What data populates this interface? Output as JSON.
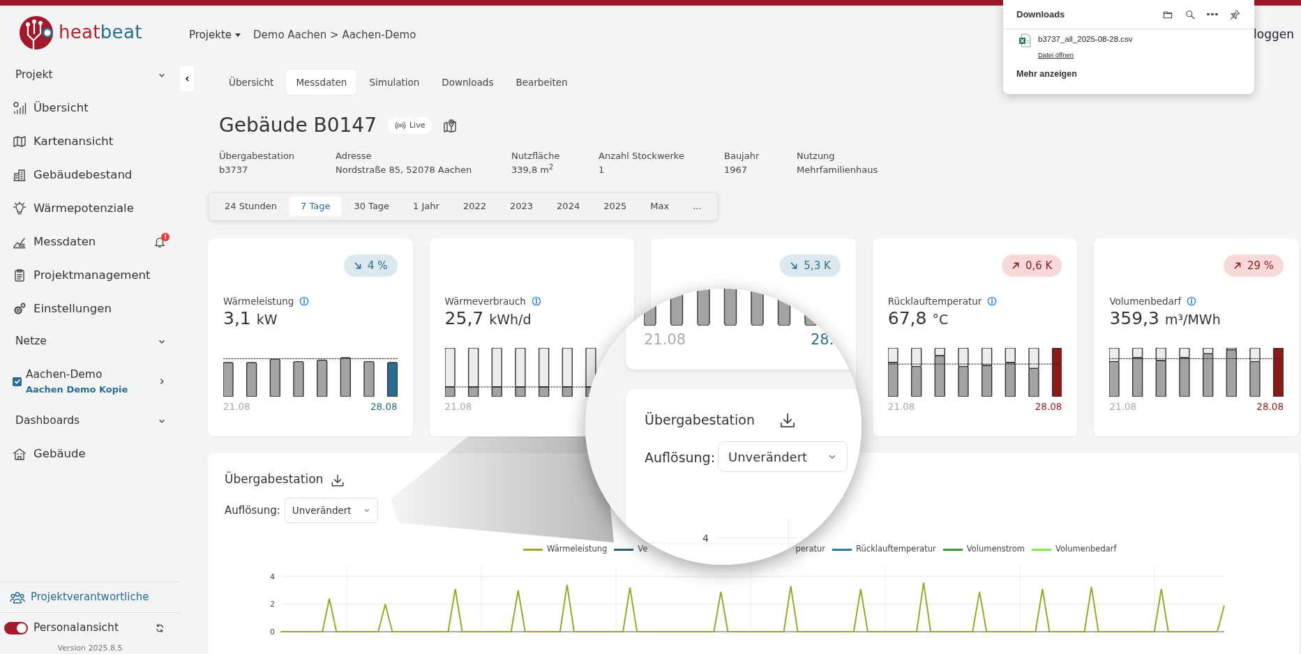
{
  "brand": {
    "part1": "heat",
    "part2": "beat"
  },
  "sidebar": {
    "groups": [
      {
        "title": "Projekt",
        "expanded": true,
        "items": [
          {
            "label": "Übersicht"
          },
          {
            "label": "Kartenansicht"
          },
          {
            "label": "Gebäudebestand"
          },
          {
            "label": "Wärmepotenziale"
          },
          {
            "label": "Messdaten",
            "alert": "!"
          },
          {
            "label": "Projektmanagement"
          },
          {
            "label": "Einstellungen"
          }
        ]
      },
      {
        "title": "Netze",
        "expanded": true,
        "networks": [
          {
            "name": "Aachen-Demo",
            "subtitle": "Aachen Demo Kopie",
            "checked": true
          }
        ]
      },
      {
        "title": "Dashboards",
        "expanded": true,
        "items": [
          {
            "label": "Gebäude"
          }
        ]
      }
    ],
    "footer_link": "Projektverantwortliche",
    "toggle": {
      "label": "Personalansicht",
      "on": true
    },
    "version": "Version 2025.8.5"
  },
  "header": {
    "projects_menu": "Projekte",
    "breadcrumb": "Demo Aachen > Aachen-Demo",
    "logout": "loggen"
  },
  "tabs": [
    {
      "label": "Übersicht",
      "selected": false
    },
    {
      "label": "Messdaten",
      "selected": true
    },
    {
      "label": "Simulation",
      "selected": false
    },
    {
      "label": "Downloads",
      "selected": false
    },
    {
      "label": "Bearbeiten",
      "selected": false
    }
  ],
  "building": {
    "title": "Gebäude B0147",
    "live": "Live",
    "facts": [
      {
        "label": "Übergabestation",
        "value": "b3737"
      },
      {
        "label": "Adresse",
        "value": "Nordstraße 85, 52078 Aachen"
      },
      {
        "label": "Nutzfläche",
        "value": "339,8 m$^{2}$"
      },
      {
        "label": "Anzahl Stockwerke",
        "value": "1"
      },
      {
        "label": "Baujahr",
        "value": "1967"
      },
      {
        "label": "Nutzung",
        "value": "Mehrfamilienhaus"
      }
    ]
  },
  "periods": [
    {
      "label": "24 Stunden",
      "selected": false
    },
    {
      "label": "7 Tage",
      "selected": true
    },
    {
      "label": "30 Tage",
      "selected": false
    },
    {
      "label": "1 Jahr",
      "selected": false
    },
    {
      "label": "2022",
      "selected": false
    },
    {
      "label": "2023",
      "selected": false
    },
    {
      "label": "2024",
      "selected": false
    },
    {
      "label": "2025",
      "selected": false
    },
    {
      "label": "Max",
      "selected": false
    },
    {
      "label": "...",
      "selected": false
    }
  ],
  "kpis": [
    {
      "title": "Wärmeleistung",
      "value": "3,1",
      "unit": "kW",
      "rising": false,
      "change": "4 %",
      "dates": [
        "21.08",
        "28.08"
      ]
    },
    {
      "title": "Wärmeverbrauch",
      "value": "25,7",
      "unit": "kWh/d",
      "dates": [
        "21.08"
      ]
    },
    {
      "rising": false,
      "change": "5,3 K"
    },
    {
      "title": "Rücklauftemperatur",
      "value": "67,8",
      "unit": "°C",
      "rising": true,
      "change": "0,6 K",
      "dates": [
        "21.08",
        "28.08"
      ]
    },
    {
      "title": "Volumenbedarf",
      "value": "359,3",
      "unit": "m³/MWh",
      "rising": true,
      "change": "29 %",
      "dates": [
        "21.08",
        "28.08"
      ]
    }
  ],
  "panel": {
    "title": "Übergabestation",
    "resolution_label": "Auflösung:",
    "resolution": "Unverändert",
    "legend": [
      {
        "label": "Ve",
        "color": "#2f5f7d"
      },
      {
        "label": "peratur",
        "covered_before": true
      },
      {
        "label": "Rücklauftemperatur",
        "color": "#2e78a8"
      },
      {
        "label": "Volumenstrom",
        "color": "#3a9a3a"
      },
      {
        "label": "Volumenbedarf",
        "color": "#7ce84a"
      }
    ],
    "chart_data": {
      "type": "line",
      "ylim": [
        0,
        4.8
      ],
      "yticks": [
        0,
        2,
        4
      ],
      "categories": [
        null,
        null,
        null,
        null,
        null,
        null,
        null,
        null,
        null,
        null,
        null,
        null,
        null,
        null,
        null,
        null,
        null,
        null,
        null,
        null,
        null,
        null,
        null,
        null,
        null,
        null,
        null,
        null,
        null,
        null,
        null,
        null,
        null,
        null,
        null,
        null,
        null,
        null,
        null,
        null,
        null,
        null,
        null,
        null,
        null,
        null,
        null,
        null,
        null,
        null,
        null,
        null,
        null,
        null,
        null,
        null,
        null,
        null,
        null,
        null,
        null,
        null,
        null,
        null,
        null,
        null,
        null,
        null,
        null,
        null,
        null,
        null,
        null,
        null,
        null,
        null,
        null,
        null,
        null,
        null,
        null,
        null,
        null,
        null,
        null,
        null,
        null,
        null,
        null,
        null,
        null,
        null,
        null,
        null,
        null,
        null,
        null,
        null,
        null,
        null,
        null,
        null,
        null,
        null,
        null,
        null,
        null,
        null,
        null,
        null,
        null,
        null,
        null,
        null,
        null,
        null,
        null,
        null,
        null,
        null,
        null,
        null,
        null,
        null,
        null,
        null,
        null,
        null,
        null,
        null,
        null,
        null,
        null,
        null,
        null,
        null
      ],
      "series": [
        {
          "name": "Wärmeleistung",
          "color": "#9ba62b",
          "values": [
            0,
            0,
            0,
            0,
            0,
            0,
            0,
            2.4,
            0,
            0,
            0,
            0,
            0,
            0,
            0,
            2.0,
            0,
            0,
            0,
            0,
            0,
            0,
            0,
            0,
            0,
            3.1,
            0,
            0,
            0,
            0,
            0,
            0,
            0,
            0,
            3.0,
            0,
            0,
            0,
            0,
            0,
            0,
            3.4,
            0,
            0,
            0,
            0,
            0,
            0,
            0,
            0,
            3.2,
            0,
            0,
            0,
            0,
            0,
            0,
            0,
            0,
            0,
            0,
            0,
            0,
            2.9,
            0,
            0,
            0,
            0,
            0,
            0,
            0,
            0,
            0,
            3.3,
            0,
            0,
            0,
            0,
            0,
            0,
            0,
            0,
            0,
            3.1,
            0,
            0,
            0,
            0,
            0,
            0,
            0,
            0,
            3.55,
            0,
            0,
            0,
            0,
            0,
            0,
            0,
            2.9,
            0,
            0,
            0,
            0,
            0,
            0,
            0,
            0,
            3.1,
            0,
            0,
            0,
            0,
            0,
            0,
            3.25,
            0,
            0,
            0,
            0,
            0,
            0,
            0,
            0,
            0,
            3.1,
            0,
            0,
            0,
            0,
            0,
            0,
            0,
            0,
            1.9
          ]
        }
      ]
    }
  },
  "magnifier": {
    "dates": [
      "21.08",
      "28."
    ],
    "title": "Übergabestation",
    "resolution_label": "Auflösung:",
    "resolution": "Unverändert",
    "tick": "4"
  },
  "downloads_popup": {
    "title": "Downloads",
    "file": "b3737_all_2025-08-28.csv",
    "open_link": "Datei öffnen",
    "more": "Mehr anzeigen"
  }
}
